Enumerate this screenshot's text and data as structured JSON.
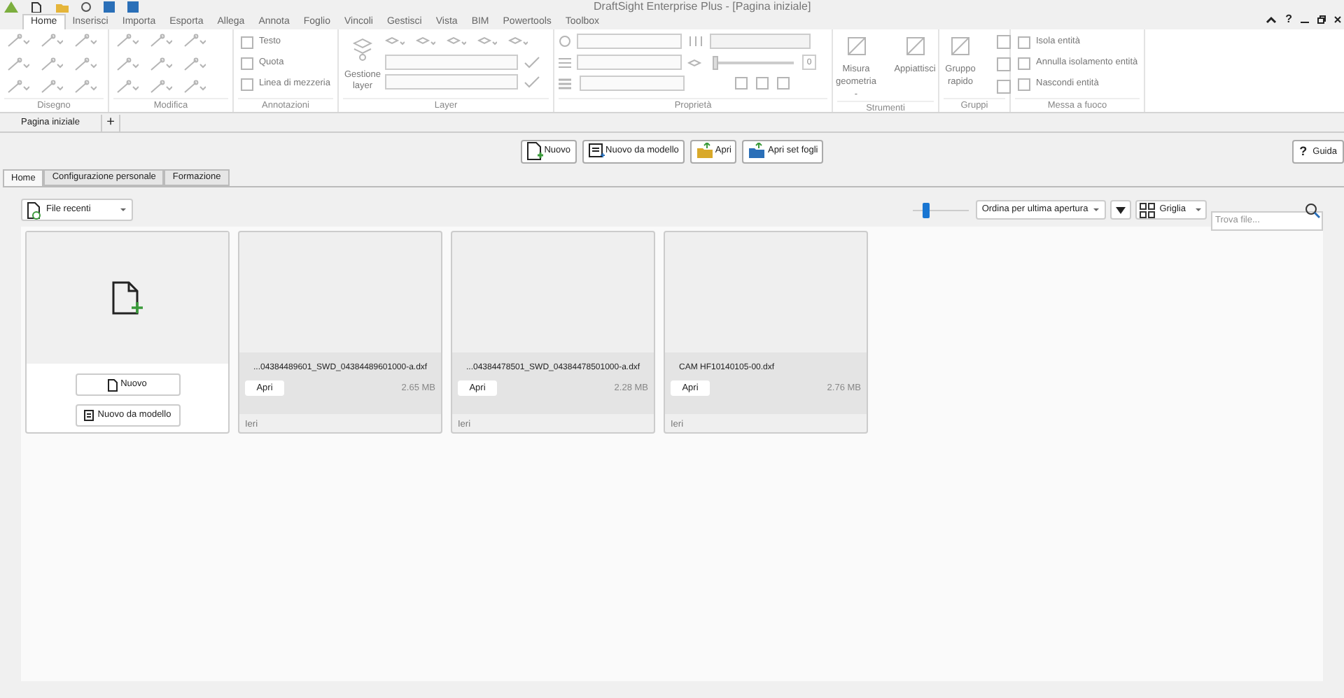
{
  "window": {
    "title": "DraftSight Enterprise Plus - [Pagina iniziale]",
    "help_glyph": "?"
  },
  "menu_tabs": [
    {
      "label": "Home",
      "selected": true
    },
    {
      "label": "Inserisci",
      "selected": false
    },
    {
      "label": "Importa",
      "selected": false
    },
    {
      "label": "Esporta",
      "selected": false
    },
    {
      "label": "Allega",
      "selected": false
    },
    {
      "label": "Annota",
      "selected": false
    },
    {
      "label": "Foglio",
      "selected": false
    },
    {
      "label": "Vincoli",
      "selected": false
    },
    {
      "label": "Gestisci",
      "selected": false
    },
    {
      "label": "Vista",
      "selected": false
    },
    {
      "label": "BIM",
      "selected": false
    },
    {
      "label": "Powertools",
      "selected": false
    },
    {
      "label": "Toolbox",
      "selected": false
    }
  ],
  "ribbon_groups": [
    {
      "kind": "icons",
      "label": "Disegno"
    },
    {
      "kind": "icons",
      "label": "Modifica"
    },
    {
      "kind": "list",
      "label": "Annotazioni",
      "items": [
        "Testo",
        "Quota",
        "Linea di mezzeria"
      ]
    },
    {
      "kind": "layer",
      "label": "Layer",
      "items": [
        "Gestione layer"
      ]
    },
    {
      "kind": "properties",
      "label": "Proprietà",
      "level": 0.0,
      "reading": "0"
    },
    {
      "kind": "large",
      "label": "Strumenti",
      "items": [
        "Misura geometria -",
        "Appiattisci"
      ]
    },
    {
      "kind": "large",
      "label": "Gruppi",
      "items": [
        "Gruppo rapido"
      ]
    },
    {
      "kind": "list",
      "label": "Messa a fuoco",
      "items": [
        "Isola entità",
        "Annulla isolamento entità",
        "Nascondi entità"
      ]
    }
  ],
  "document_tabs": [
    {
      "label": "Pagina iniziale",
      "selected": true
    }
  ],
  "new_tab_glyph": "+",
  "actions": [
    "Nuovo",
    "Nuovo da modello",
    "Apri",
    "Apri set fogli"
  ],
  "guide": {
    "glyph": "?",
    "label": "Guida"
  },
  "page_tabs": [
    {
      "label": "Home",
      "selected": true
    },
    {
      "label": "Configurazione personale",
      "selected": false
    },
    {
      "label": "Formazione",
      "selected": false
    }
  ],
  "toolbar": {
    "source": "File recenti",
    "zoom": {
      "level": 0.2
    },
    "sort": "Ordina per ultima apertura",
    "view": "Griglia",
    "search": {
      "placeholder": "Trova file..."
    }
  },
  "new_card": {
    "buttons": [
      "Nuovo",
      "Nuovo da modello"
    ]
  },
  "files": [
    {
      "name": "...04384489601_SWD_04384489601000-a.dxf",
      "open": "Apri",
      "size": "2.65 MB",
      "date": "Ieri"
    },
    {
      "name": "...04384478501_SWD_04384478501000-a.dxf",
      "open": "Apri",
      "size": "2.28 MB",
      "date": "Ieri"
    },
    {
      "name": "CAM HF10140105-00.dxf",
      "open": "Apri",
      "size": "2.76 MB",
      "date": "Ieri"
    }
  ]
}
